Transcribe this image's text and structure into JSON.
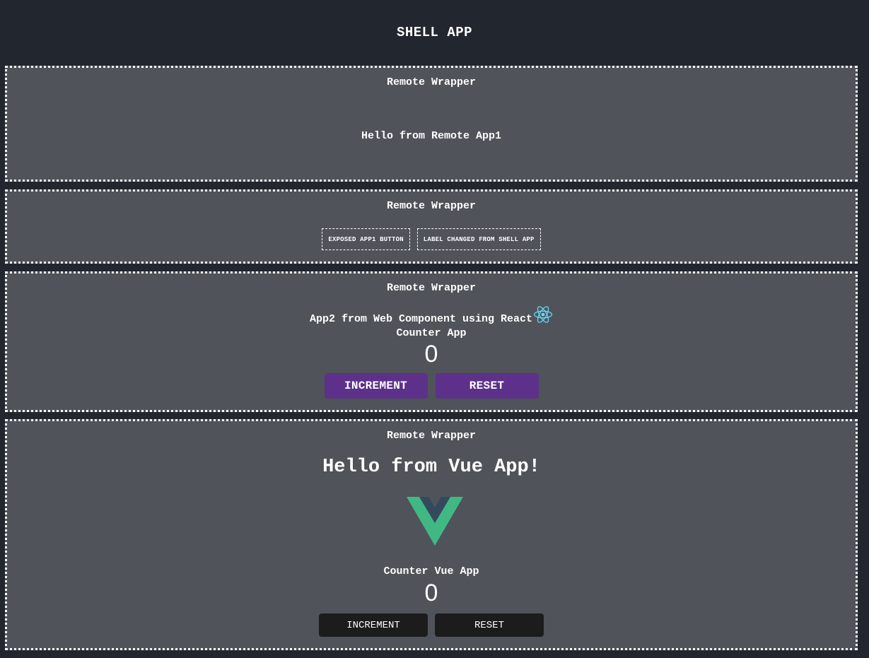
{
  "header": {
    "title": "SHELL APP"
  },
  "wrappers": {
    "w1": {
      "title": "Remote Wrapper",
      "message": "Hello from Remote App1"
    },
    "w2": {
      "title": "Remote Wrapper",
      "buttons": [
        "EXPOSED APP1 BUTTON",
        "LABEL CHANGED FROM SHELL APP"
      ]
    },
    "w3": {
      "title": "Remote Wrapper",
      "heading": "App2 from Web Component using React",
      "subheading": "Counter App",
      "count": "0",
      "increment_label": "INCREMENT",
      "reset_label": "RESET"
    },
    "w4": {
      "title": "Remote Wrapper",
      "heading": "Hello from Vue App!",
      "subheading": "Counter Vue App",
      "count": "0",
      "increment_label": "INCREMENT",
      "reset_label": "RESET"
    }
  },
  "icons": {
    "react": "react-logo-icon",
    "vue": "vue-logo-icon"
  },
  "colors": {
    "page_bg": "#22262e",
    "wrapper_bg": "#505359",
    "purple_button": "#5d318a",
    "dark_button": "#1c1c1c",
    "react": "#61dafb",
    "vue_green": "#41b883",
    "vue_dark": "#34495e"
  }
}
